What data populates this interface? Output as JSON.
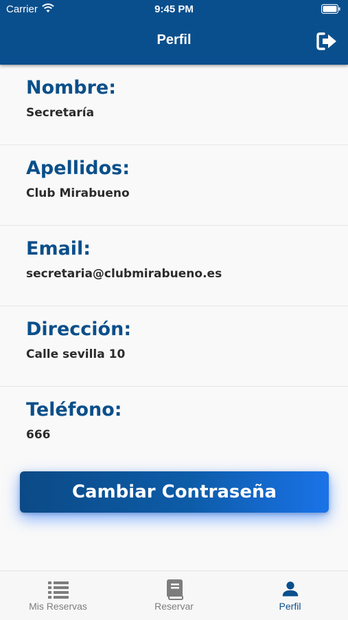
{
  "status_bar": {
    "carrier": "Carrier",
    "time": "9:45 PM"
  },
  "header": {
    "title": "Perfil"
  },
  "fields": [
    {
      "label": "Nombre:",
      "value": "Secretaría"
    },
    {
      "label": "Apellidos:",
      "value": "Club Mirabueno"
    },
    {
      "label": "Email:",
      "value": "secretaria@clubmirabueno.es"
    },
    {
      "label": "Dirección:",
      "value": "Calle sevilla 10"
    },
    {
      "label": "Teléfono:",
      "value": "666"
    }
  ],
  "actions": {
    "change_password": "Cambiar Contraseña"
  },
  "tabs": [
    {
      "label": "Mis Reservas",
      "icon": "list-icon"
    },
    {
      "label": "Reservar",
      "icon": "book-icon"
    },
    {
      "label": "Perfil",
      "icon": "person-icon"
    }
  ],
  "colors": {
    "primary": "#0a4f8d",
    "button_end": "#1a73e8",
    "inactive": "#7d7d7d"
  }
}
